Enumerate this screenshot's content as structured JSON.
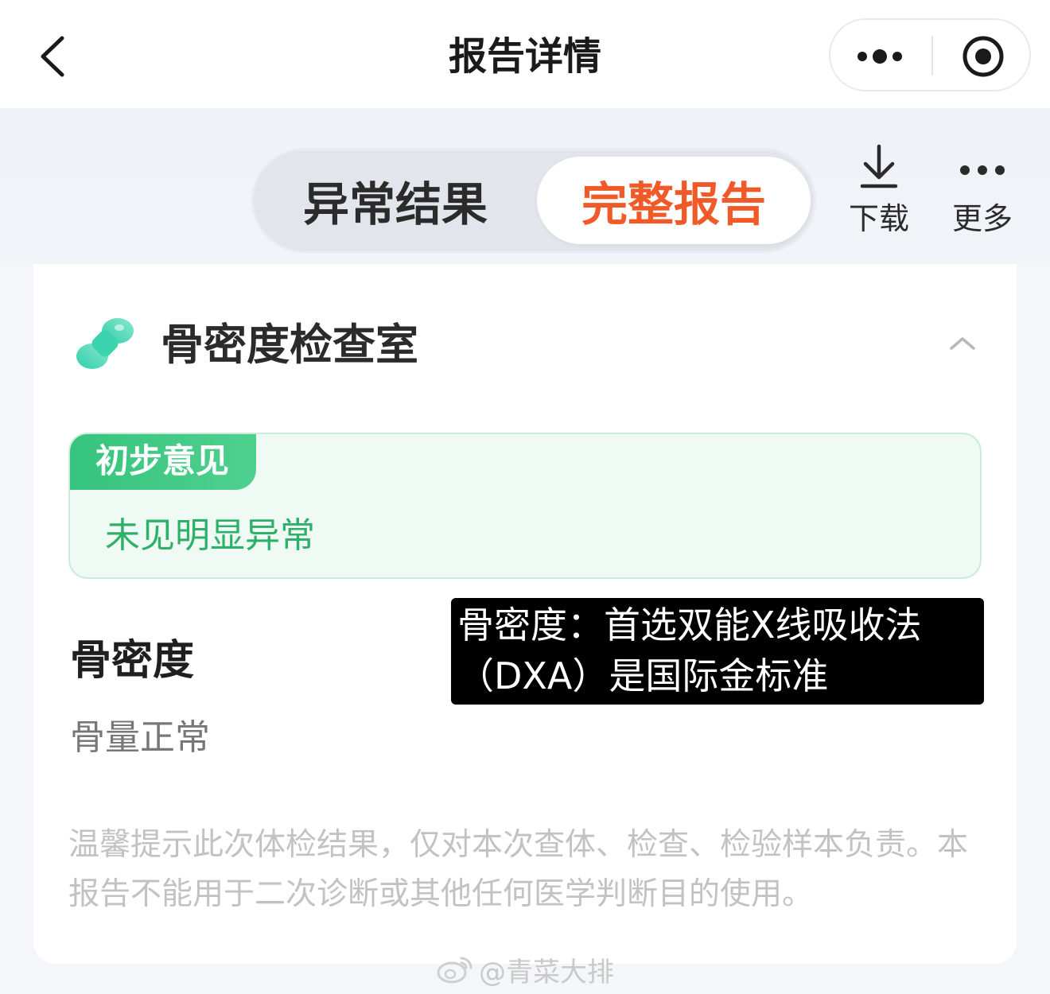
{
  "navbar": {
    "title": "报告详情",
    "back_icon": "chevron-left-icon",
    "more_icon": "ellipsis-icon",
    "close_icon": "target-circle-icon"
  },
  "tabs": {
    "items": [
      {
        "label": "异常结果",
        "active": false
      },
      {
        "label": "完整报告",
        "active": true
      }
    ],
    "active_color": "#f05a28"
  },
  "actions": {
    "download": {
      "label": "下载",
      "icon": "download-icon"
    },
    "more": {
      "label": "更多",
      "icon": "more-dots-icon"
    }
  },
  "department": {
    "name": "骨密度检查室",
    "icon": "bone-icon",
    "expanded": true
  },
  "preliminary": {
    "tag": "初步意见",
    "text": "未见明显异常",
    "accent": "#36c47d"
  },
  "caption": {
    "line1": "骨密度：首选双能X线吸收法",
    "line2": "（DXA）是国际金标准"
  },
  "item": {
    "title": "骨密度",
    "value": "骨量正常"
  },
  "disclaimer": "温馨提示此次体检结果，仅对本次查体、检查、检验样本负责。本报告不能用于二次诊断或其他任何医学判断目的使用。",
  "watermark": {
    "text": "@青菜大排",
    "icon": "weibo-logo-icon"
  }
}
